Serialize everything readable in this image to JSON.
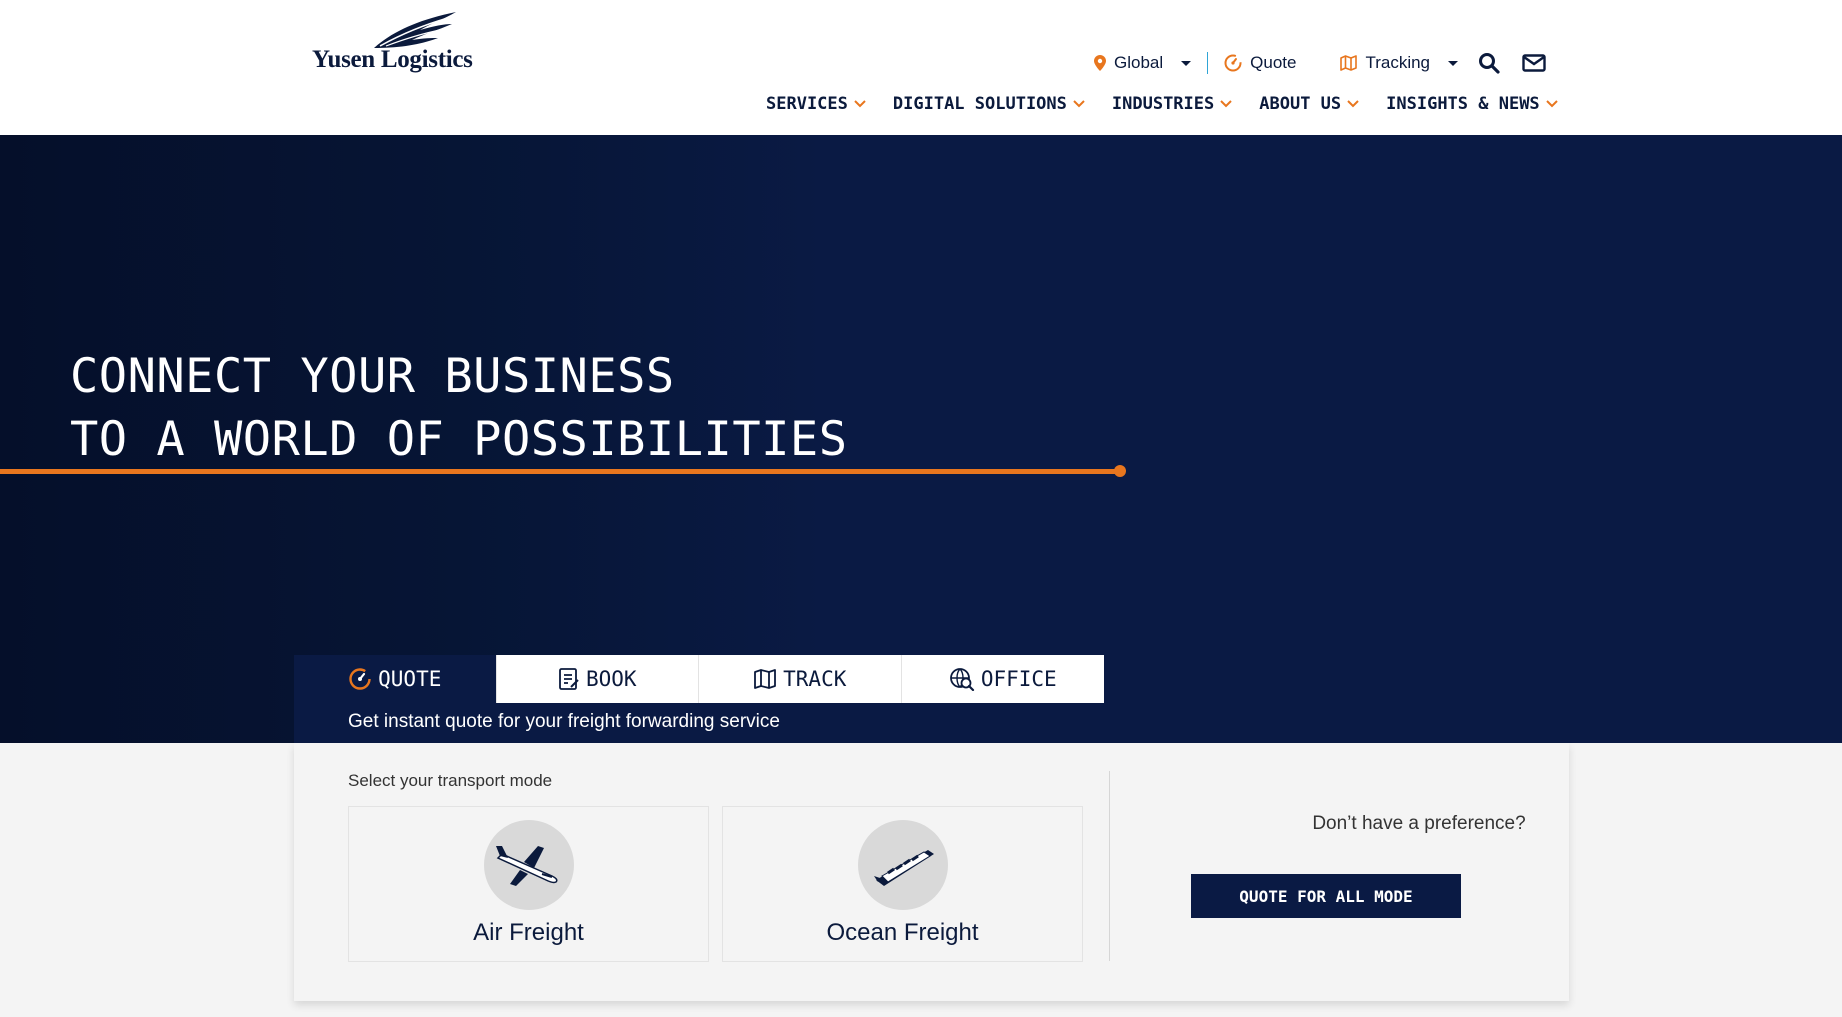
{
  "header": {
    "logo_text": "Yusen Logistics",
    "util": {
      "region": "Global",
      "quote": "Quote",
      "tracking": "Tracking"
    },
    "nav": [
      {
        "label": "SERVICES"
      },
      {
        "label": "DIGITAL SOLUTIONS"
      },
      {
        "label": "INDUSTRIES"
      },
      {
        "label": "ABOUT US"
      },
      {
        "label": "INSIGHTS & NEWS"
      }
    ]
  },
  "hero": {
    "line1": "CONNECT YOUR BUSINESS",
    "line2": "TO A WORLD OF POSSIBILITIES"
  },
  "widget": {
    "tabs": [
      {
        "label": "QUOTE",
        "icon": "quote-icon",
        "active": true
      },
      {
        "label": "BOOK",
        "icon": "book-icon",
        "active": false
      },
      {
        "label": "TRACK",
        "icon": "map-icon",
        "active": false
      },
      {
        "label": "OFFICE",
        "icon": "office-search-icon",
        "active": false
      }
    ],
    "subtitle": "Get instant quote for your freight forwarding service",
    "select_label": "Select your transport mode",
    "modes": [
      {
        "label": "Air Freight",
        "icon": "airplane-icon"
      },
      {
        "label": "Ocean Freight",
        "icon": "ship-icon"
      }
    ],
    "preference_text": "Don’t have a preference?",
    "quote_all_label": "QUOTE FOR ALL MODE"
  },
  "colors": {
    "navy": "#0a1a44",
    "accent_orange": "#e8761e",
    "divider_blue": "#2fa5d6"
  }
}
